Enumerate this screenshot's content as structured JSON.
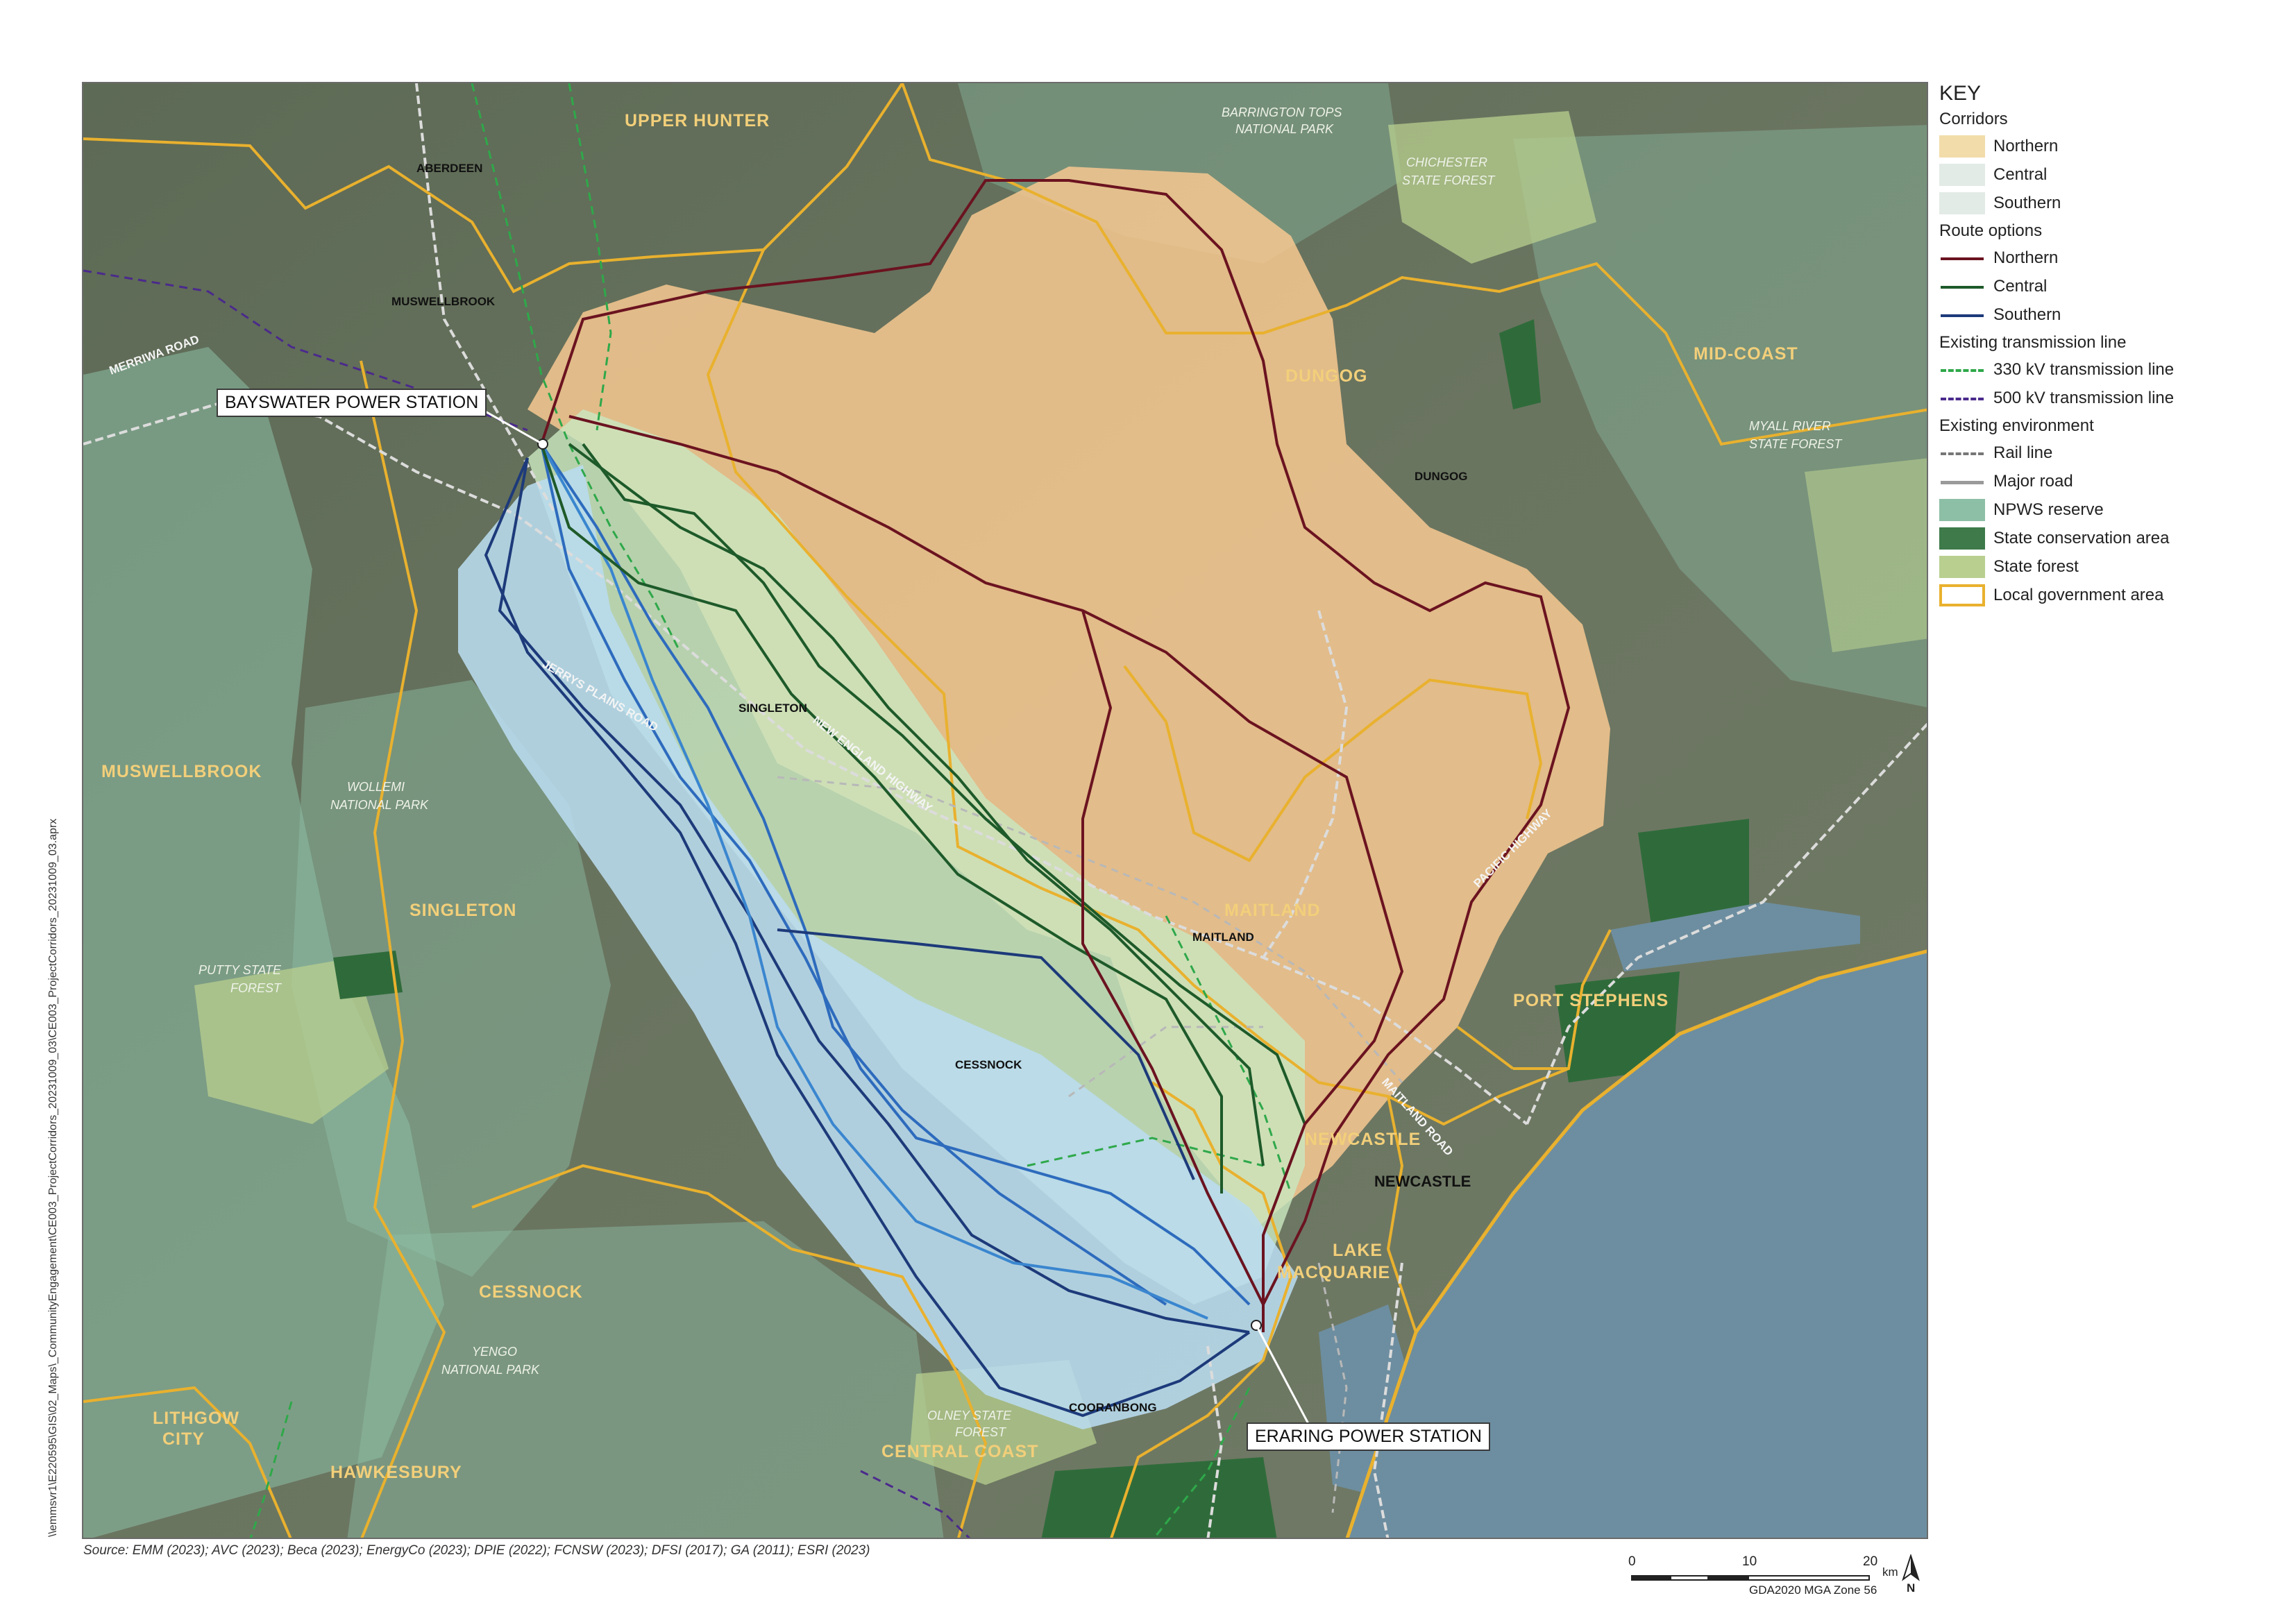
{
  "map": {
    "lga_labels": [
      "UPPER HUNTER",
      "DUNGOG",
      "MID-COAST",
      "MUSWELLBROOK",
      "SINGLETON",
      "MAITLAND",
      "PORT STEPHENS",
      "NEWCASTLE",
      "LAKE",
      "MACQUARIE",
      "CESSNOCK",
      "LITHGOW",
      "CITY",
      "HAWKESBURY",
      "CENTRAL COAST"
    ],
    "park_labels": [
      "BARRINGTON TOPS",
      "NATIONAL PARK",
      "CHICHESTER",
      "STATE FOREST",
      "MYALL RIVER",
      "STATE FOREST",
      "WOLLEMI",
      "NATIONAL PARK",
      "PUTTY STATE",
      "FOREST",
      "YENGO",
      "NATIONAL PARK",
      "OLNEY STATE",
      "FOREST"
    ],
    "town_labels": [
      "ABERDEEN",
      "MUSWELLBROOK",
      "DUNGOG",
      "SINGLETON",
      "MAITLAND",
      "CESSNOCK",
      "NEWCASTLE",
      "COORANBONG"
    ],
    "road_labels": [
      "MERRIWA ROAD",
      "JERRYS PLAINS ROAD",
      "NEW ENGLAND HIGHWAY",
      "PACIFIC HIGHWAY",
      "MAITLAND ROAD"
    ],
    "callouts": {
      "bayswater": "BAYSWATER POWER STATION",
      "eraring": "ERARING POWER STATION"
    }
  },
  "legend": {
    "title": "KEY",
    "groups": {
      "corridors": "Corridors",
      "routes": "Route options",
      "transmission": "Existing transmission line",
      "environment": "Existing environment"
    },
    "items": {
      "corridor_northern": "Northern",
      "corridor_central": "Central",
      "corridor_southern": "Southern",
      "route_northern": "Northern",
      "route_central": "Central",
      "route_southern": "Southern",
      "line_330": "330 kV transmission line",
      "line_500": "500 kV transmission line",
      "rail": "Rail line",
      "road": "Major road",
      "npws": "NPWS reserve",
      "state_conservation": "State conservation area",
      "state_forest": "State forest",
      "lga": "Local government area"
    }
  },
  "colors": {
    "corridor_northern": "#f2c690",
    "corridor_central": "#c9e6c0",
    "corridor_southern": "#b9dcef",
    "route_northern": "#6b1320",
    "route_central": "#1e5a2a",
    "route_southern": "#1d3a7a",
    "line_330": "#2fa84a",
    "line_500": "#4b2a8c",
    "npws": "#8dbfa6",
    "state_conservation": "#3e7a4a",
    "state_forest": "#b8cf8f",
    "lga": "#e9b12e",
    "sea": "#6d8ea0"
  },
  "source_note": "Source: EMM (2023); AVC (2023); Beca (2023); EnergyCo (2023); DPIE (2022); FCNSW (2023); DFSI (2017); GA (2011); ESRI (2023)",
  "side_path": "\\\\emmsvr1\\E220595\\GIS\\02_Maps\\_CommunityEngagement\\CE003_ProjectCorridors_20231009_03\\CE003_ProjectCorridors_20231009_03.aprx",
  "scale": {
    "ticks": [
      "0",
      "10",
      "20"
    ],
    "unit": "km",
    "crs": "GDA2020 MGA Zone 56"
  },
  "north_label": "N"
}
